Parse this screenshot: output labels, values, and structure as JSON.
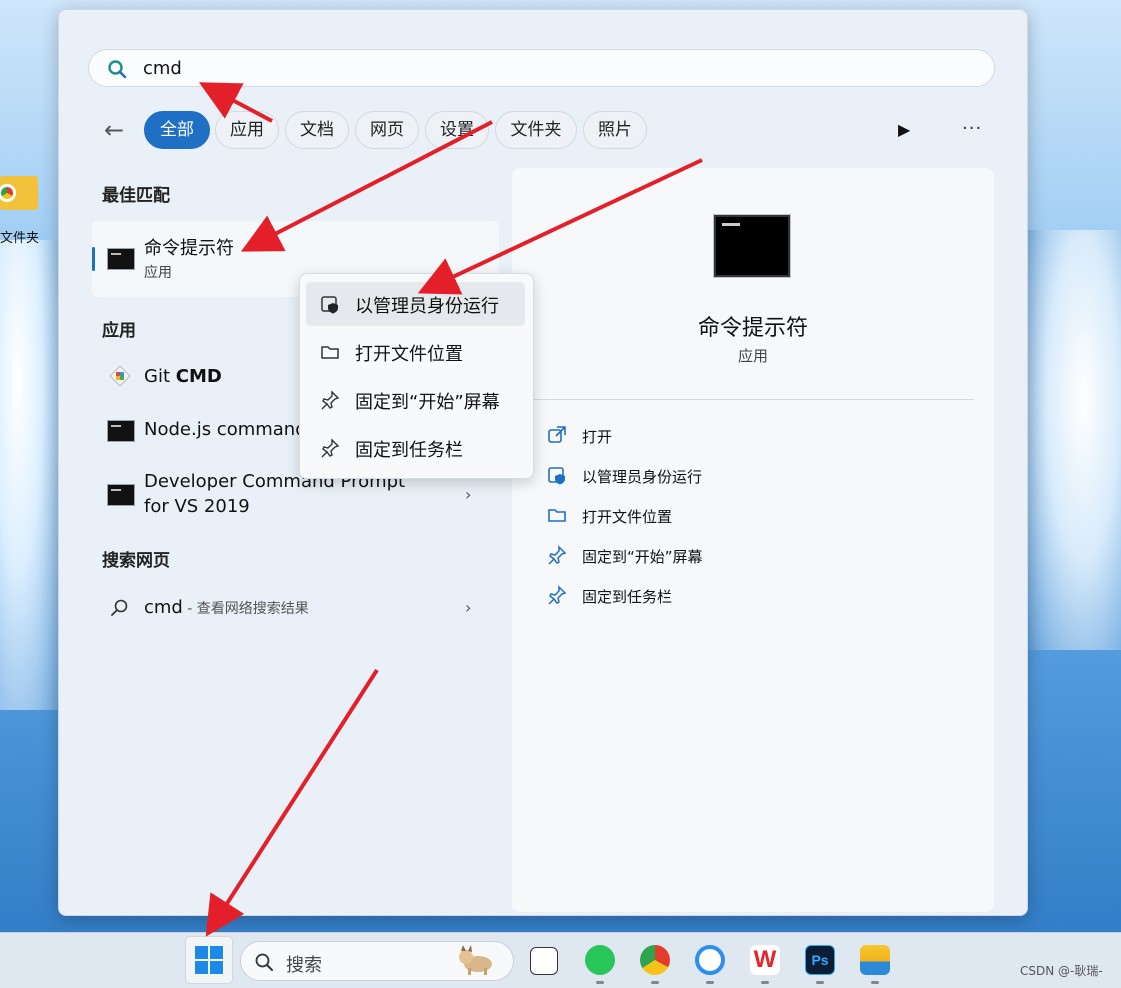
{
  "desktop": {
    "folder_label": "文件夹"
  },
  "search": {
    "query": "cmd"
  },
  "filters": {
    "back_icon": "back-arrow-icon",
    "tabs": [
      {
        "label": "全部",
        "active": true
      },
      {
        "label": "应用"
      },
      {
        "label": "文档"
      },
      {
        "label": "网页"
      },
      {
        "label": "设置"
      },
      {
        "label": "文件夹"
      },
      {
        "label": "照片"
      }
    ],
    "more_label": "···"
  },
  "results": {
    "best_match_heading": "最佳匹配",
    "best_match": {
      "title": "命令提示符",
      "subtitle": "应用"
    },
    "apps_heading": "应用",
    "apps": [
      {
        "title_prefix": "Git ",
        "title_bold": "CMD"
      },
      {
        "title": "Node.js command"
      },
      {
        "title_line1": "Developer Command Prompt",
        "title_line2": "for VS 2019"
      }
    ],
    "web_heading": "搜索网页",
    "web_query": "cmd",
    "web_suffix": " - 查看网络搜索结果"
  },
  "context_menu": {
    "items": [
      {
        "label": "以管理员身份运行",
        "icon": "admin-shield-icon",
        "highlighted": true
      },
      {
        "label": "打开文件位置",
        "icon": "folder-icon"
      },
      {
        "label": "固定到“开始”屏幕",
        "icon": "pin-icon"
      },
      {
        "label": "固定到任务栏",
        "icon": "pin-icon"
      }
    ]
  },
  "preview": {
    "title": "命令提示符",
    "subtitle": "应用",
    "actions": [
      {
        "label": "打开",
        "icon": "open-external-icon"
      },
      {
        "label": "以管理员身份运行",
        "icon": "admin-shield-icon"
      },
      {
        "label": "打开文件位置",
        "icon": "folder-icon"
      },
      {
        "label": "固定到“开始”屏幕",
        "icon": "pin-icon"
      },
      {
        "label": "固定到任务栏",
        "icon": "pin-icon"
      }
    ]
  },
  "taskbar": {
    "search_placeholder": "搜索",
    "apps": [
      "task-view-icon",
      "wechat-icon",
      "chrome-icon",
      "tencent-meeting-icon",
      "wps-icon",
      "photoshop-icon",
      "file-explorer-icon"
    ]
  },
  "watermark": "CSDN @-耿瑞-",
  "colors": {
    "accent": "#1f6fc5",
    "annotation_arrow": "#e3202a"
  }
}
